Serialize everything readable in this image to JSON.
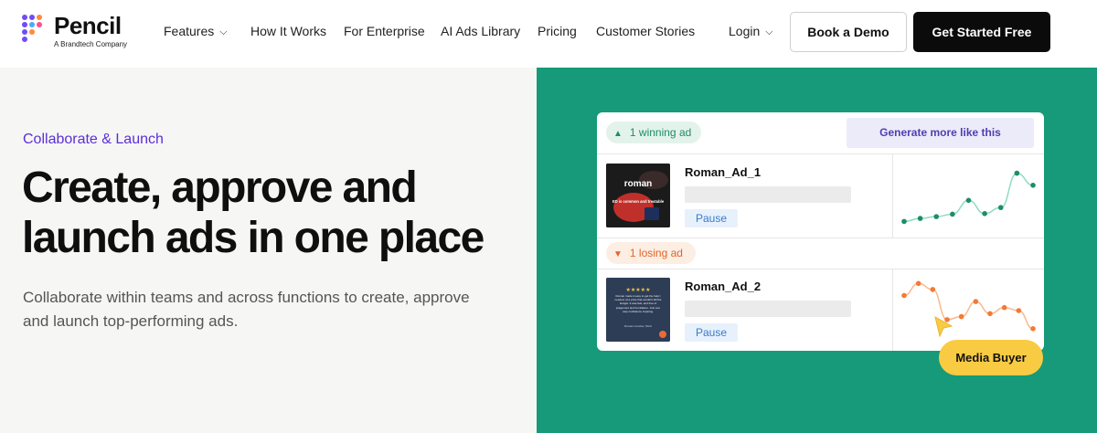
{
  "brand": {
    "name": "Pencil",
    "tagline": "A Brandtech Company"
  },
  "nav": {
    "features": "Features",
    "how_it_works": "How It Works",
    "enterprise": "For Enterprise",
    "ads_library": "AI Ads Library",
    "pricing": "Pricing",
    "stories": "Customer Stories",
    "login": "Login",
    "demo": "Book a Demo",
    "start": "Get Started Free"
  },
  "hero": {
    "eyebrow": "Collaborate & Launch",
    "headline_line1": "Create, approve and",
    "headline_line2": "launch ads in one place",
    "subtext": "Collaborate within teams and across functions to create, approve and launch top-performing ads."
  },
  "card": {
    "winning_label": "1 winning ad",
    "losing_label": "1 losing ad",
    "generate_button": "Generate more like this",
    "ads": [
      {
        "name": "Roman_Ad_1",
        "action": "Pause",
        "thumb_brand": "roman",
        "thumb_text": "ED is common and treatable",
        "trend": [
          0.1,
          0.15,
          0.18,
          0.22,
          0.45,
          0.23,
          0.33,
          0.9,
          0.7
        ]
      },
      {
        "name": "Roman_Ad_2",
        "action": "Pause",
        "thumb_stars": "★★★★★",
        "thumb_text": "Roman made it easy to get the help I needed, at a price that wouldn't kill the budget. It was fast, and free of judgement and humiliation. Just one stop confidence inspiring.",
        "thumb_author": "Roman member, NGO",
        "trend": [
          0.75,
          0.95,
          0.85,
          0.35,
          0.4,
          0.65,
          0.45,
          0.55,
          0.5,
          0.2
        ]
      }
    ],
    "badge": "Media Buyer"
  },
  "colors": {
    "accent_purple": "#5b2ed8",
    "green_bg": "#169a79",
    "win_green": "#1d8e66",
    "lose_orange": "#e0652b",
    "badge_yellow": "#f9cb42"
  },
  "icons": {
    "logo": "pencil-dots-logo",
    "dropdown": "chevron-down-icon",
    "up": "triangle-up-icon",
    "down": "triangle-down-icon",
    "cursor": "pointer-cursor-icon"
  }
}
